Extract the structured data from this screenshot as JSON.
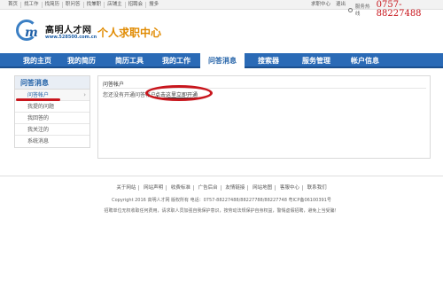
{
  "top_bar": {
    "nav": [
      "首页",
      "找工作",
      "找简历",
      "职问答",
      "找兼职",
      "店铺主",
      "招聘会",
      "搜多"
    ],
    "right_links": [
      "求职中心",
      "退出",
      "服务热线"
    ],
    "hotline_label": "服务热线",
    "hotline_number": "0757-88227488"
  },
  "logo": {
    "name": "高明人才网",
    "url": "www.528500.com.cn",
    "site_title": "个人求职中心"
  },
  "main_nav": {
    "items": [
      "我的主页",
      "我的简历",
      "简历工具",
      "我的工作",
      "问答消息",
      "搜索器",
      "服务管理",
      "帐户信息"
    ],
    "active_index": 4
  },
  "sidebar": {
    "title": "问答消息",
    "items": [
      "问答帐户",
      "我提的问题",
      "我回答的",
      "我关注的",
      "系统消息"
    ],
    "active_index": 0
  },
  "content": {
    "title": "问答帐户",
    "message": "您还没有开通问答帐户，",
    "link": "点击这里立即开通"
  },
  "footer": {
    "links": [
      "关于网站",
      "网站声明",
      "收费标准",
      "广告后台",
      "友情链接",
      "网站地图",
      "客服中心",
      "联系我们"
    ],
    "copyright": "Copyright 2016 高明人才网 版权所有 电话：0757-88227488/88227788/88227748 粤ICP备06100391号",
    "notice": "招聘单位无权收取任何费用，请求职人员加强自我保护意识，按劳动法规保护自身权益，警惕虚假招聘，避免上当受骗！"
  }
}
